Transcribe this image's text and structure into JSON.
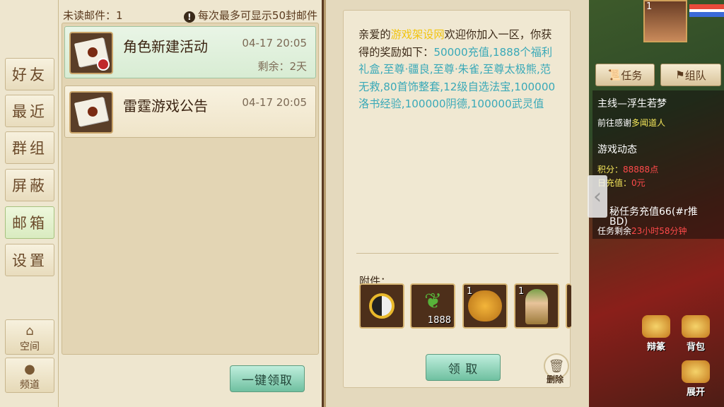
{
  "tabs": [
    {
      "label": "好友"
    },
    {
      "label": "最近"
    },
    {
      "label": "群组"
    },
    {
      "label": "屏蔽"
    },
    {
      "label": "邮箱"
    },
    {
      "label": "设置"
    }
  ],
  "bottom_tabs": [
    {
      "label": "空间",
      "icon": "house-icon"
    },
    {
      "label": "频道",
      "icon": "chat-bubble-icon"
    }
  ],
  "list": {
    "unread_label": "未读邮件：",
    "unread_count": "1",
    "notice": "每次最多可显示50封邮件",
    "mails": [
      {
        "title": "角色新建活动",
        "time": "04-17 20:05",
        "remaining": "剩余：2天"
      },
      {
        "title": "雷霆游戏公告",
        "time": "04-17 20:05"
      }
    ],
    "claim_all_label": "一键领取"
  },
  "detail": {
    "msg_1": "亲爱的",
    "msg_2": "游戏架设网",
    "msg_3": "欢迎你加入一区，你获得的奖励如下：",
    "msg_4": "50000充值,1888个福利礼盒,至尊·疆良,至尊·朱雀,至尊太极熊,范无救,80首饰整套,12级自选法宝,100000洛书经验,100000阴德,100000武灵值",
    "attachments_label": "附件：",
    "attachments": [
      {
        "icon": "yin-yang-icon"
      },
      {
        "icon": "sprout-icon",
        "count": "1888"
      },
      {
        "icon": "lion-icon",
        "level": "1"
      },
      {
        "icon": "lady-portrait-icon",
        "level": "1"
      }
    ],
    "claim_label": "领 取",
    "delete_label": "删除"
  },
  "game": {
    "player_level": "1",
    "task_tab": "任务",
    "team_tab": "组队",
    "main_quest": "主线—浮生若梦",
    "quest_hint_1": "前往感谢",
    "quest_hint_2": "多闻道人",
    "dynamic_title": "游戏动态",
    "score_1": "积分：",
    "score_2": "88888点",
    "recharge_1": "日充值：",
    "recharge_2": "0元",
    "secret_task": "秘任务充值66(#r推",
    "secret_task_2": "BD)",
    "remaining_1": "任务剩余",
    "remaining_2": "23小时58分钟",
    "side_buttons": [
      "辩篆",
      "背包",
      "展开"
    ]
  }
}
